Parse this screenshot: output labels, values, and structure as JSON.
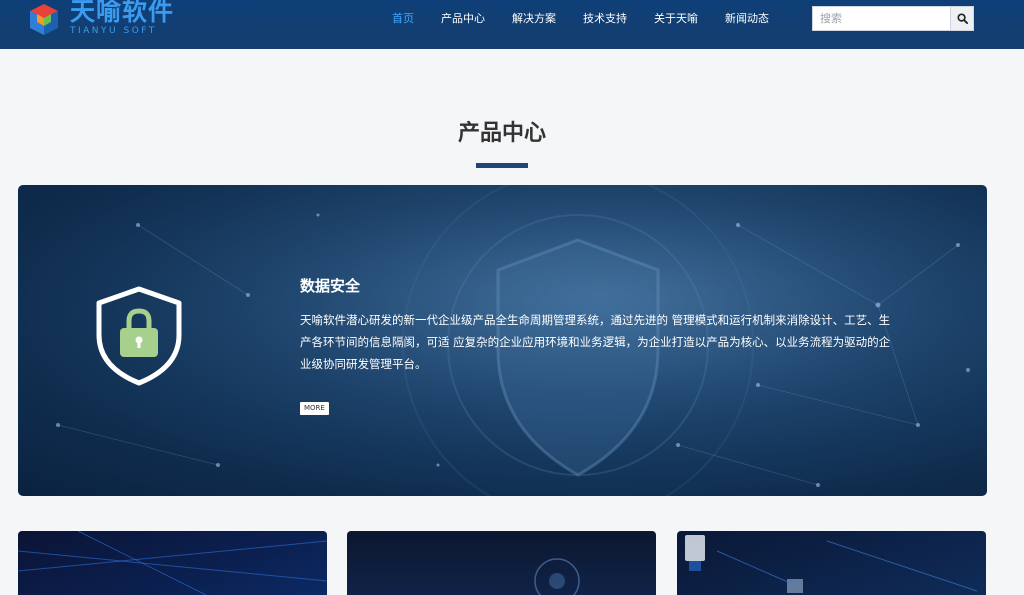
{
  "header": {
    "logo": {
      "name": "天喻软件",
      "subtitle": "TIANYU SOFT"
    },
    "nav": [
      {
        "label": "首页",
        "active": true
      },
      {
        "label": "产品中心",
        "active": false
      },
      {
        "label": "解决方案",
        "active": false
      },
      {
        "label": "技术支持",
        "active": false
      },
      {
        "label": "关于天喻",
        "active": false
      },
      {
        "label": "新闻动态",
        "active": false
      }
    ],
    "search": {
      "placeholder": "搜索",
      "icon": "search-icon"
    }
  },
  "section": {
    "title": "产品中心"
  },
  "banner": {
    "icon": "shield-lock-icon",
    "heading": "数据安全",
    "description": "天喻软件潜心研发的新一代企业级产品全生命周期管理系统，通过先进的 管理模式和运行机制来消除设计、工艺、生产各环节间的信息隔阂，可适 应复杂的企业应用环境和业务逻辑，为企业打造以产品为核心、以业务流程为驱动的企业级协同研发管理平台。",
    "more_label": "MORE"
  },
  "colors": {
    "header_bg": "#143e6e",
    "nav_active": "#3fa7ff",
    "logo_blue": "#3a9bf0",
    "title_bar": "#1f4674",
    "lock_green": "#a8d08d"
  }
}
